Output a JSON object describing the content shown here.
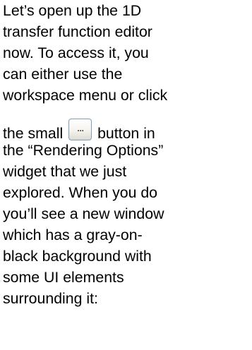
{
  "lines": [
    "Let’s open up the 1D",
    "transfer function editor",
    "now.  To access it, you",
    "can either use the",
    "workspace menu  or click",
    "the small",
    "button in",
    "the “Rendering Options”",
    "widget that we just",
    "explored.  When you do",
    "you’ll see a new window",
    "which has a gray-on-",
    "black background with",
    "some UI elements",
    "surrounding it:"
  ],
  "inline_button": {
    "label": "...",
    "icon": "ellipsis-button-icon"
  }
}
